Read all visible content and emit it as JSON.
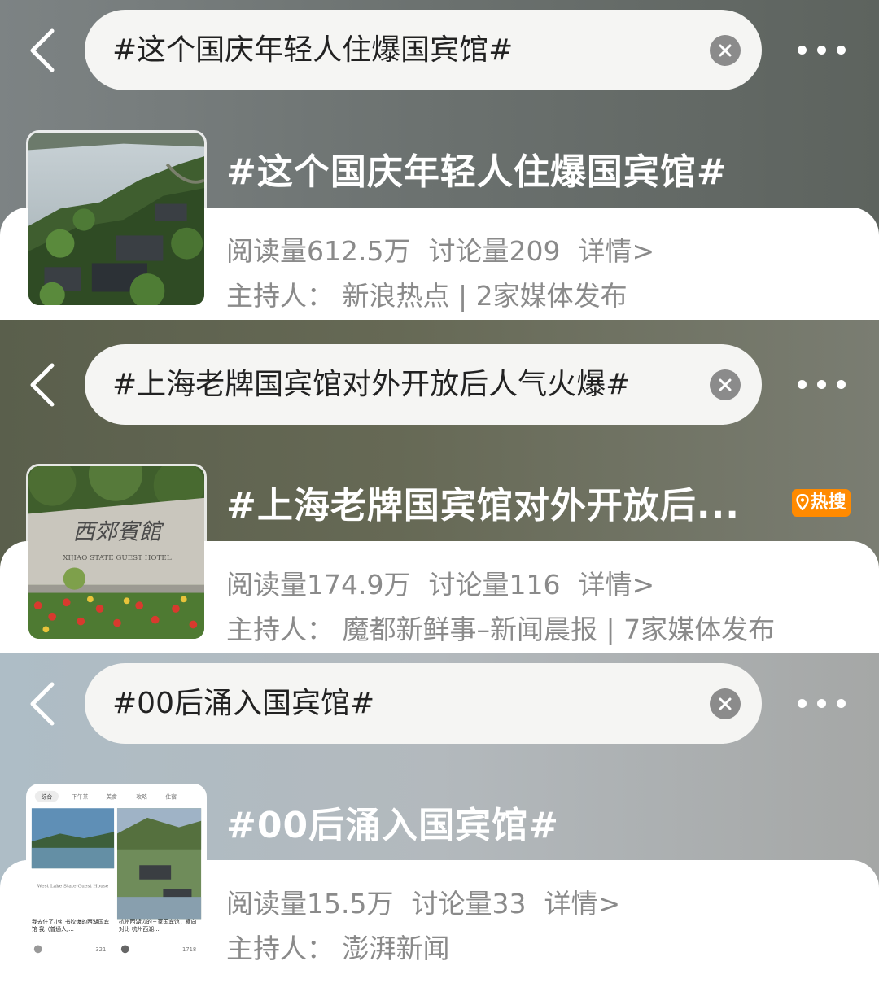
{
  "topics": [
    {
      "search_query": "#这个国庆年轻人住爆国宾馆#",
      "title": "#这个国庆年轻人住爆国宾馆#",
      "reads": "阅读量612.5万",
      "discussions": "讨论量209",
      "detail_link": "详情>",
      "host_line": "主持人：  新浪热点 | 2家媒体发布",
      "badge": ""
    },
    {
      "search_query": "#上海老牌国宾馆对外开放后人气火爆#",
      "title": "#上海老牌国宾馆对外开放后...",
      "reads": "阅读量174.9万",
      "discussions": "讨论量116",
      "detail_link": "详情>",
      "host_line": "主持人：  魔都新鲜事–新闻晨报 | 7家媒体发布",
      "badge": "热搜"
    },
    {
      "search_query": "#00后涌入国宾馆#",
      "title": "#00后涌入国宾馆#",
      "reads": "阅读量15.5万",
      "discussions": "讨论量33",
      "detail_link": "详情>",
      "host_line": "主持人：  澎湃新闻",
      "badge": ""
    }
  ],
  "thumbnail_3": {
    "tabs": [
      "综合",
      "下午茶",
      "美食",
      "攻略",
      "住宿"
    ],
    "left_caption_en": "West Lake State Guest House",
    "left_post": "我去住了小红书吹爆的西湖国宾馆 我（普通人,…",
    "left_likes": "321",
    "right_post": "杭州西湖边的三家国宾馆，横向对比 杭州西湖…",
    "right_likes": "1718"
  },
  "thumbnail_2": {
    "sign_cn": "西郊賓館",
    "sign_en": "XIJIAO STATE GUEST HOTEL"
  },
  "colors": {
    "badge": "#ff8a00",
    "card": "#ffffff",
    "meta_text": "#8a8a8a"
  },
  "icons": [
    "back-arrow-icon",
    "clear-icon",
    "more-dots-icon",
    "location-pin-icon"
  ]
}
